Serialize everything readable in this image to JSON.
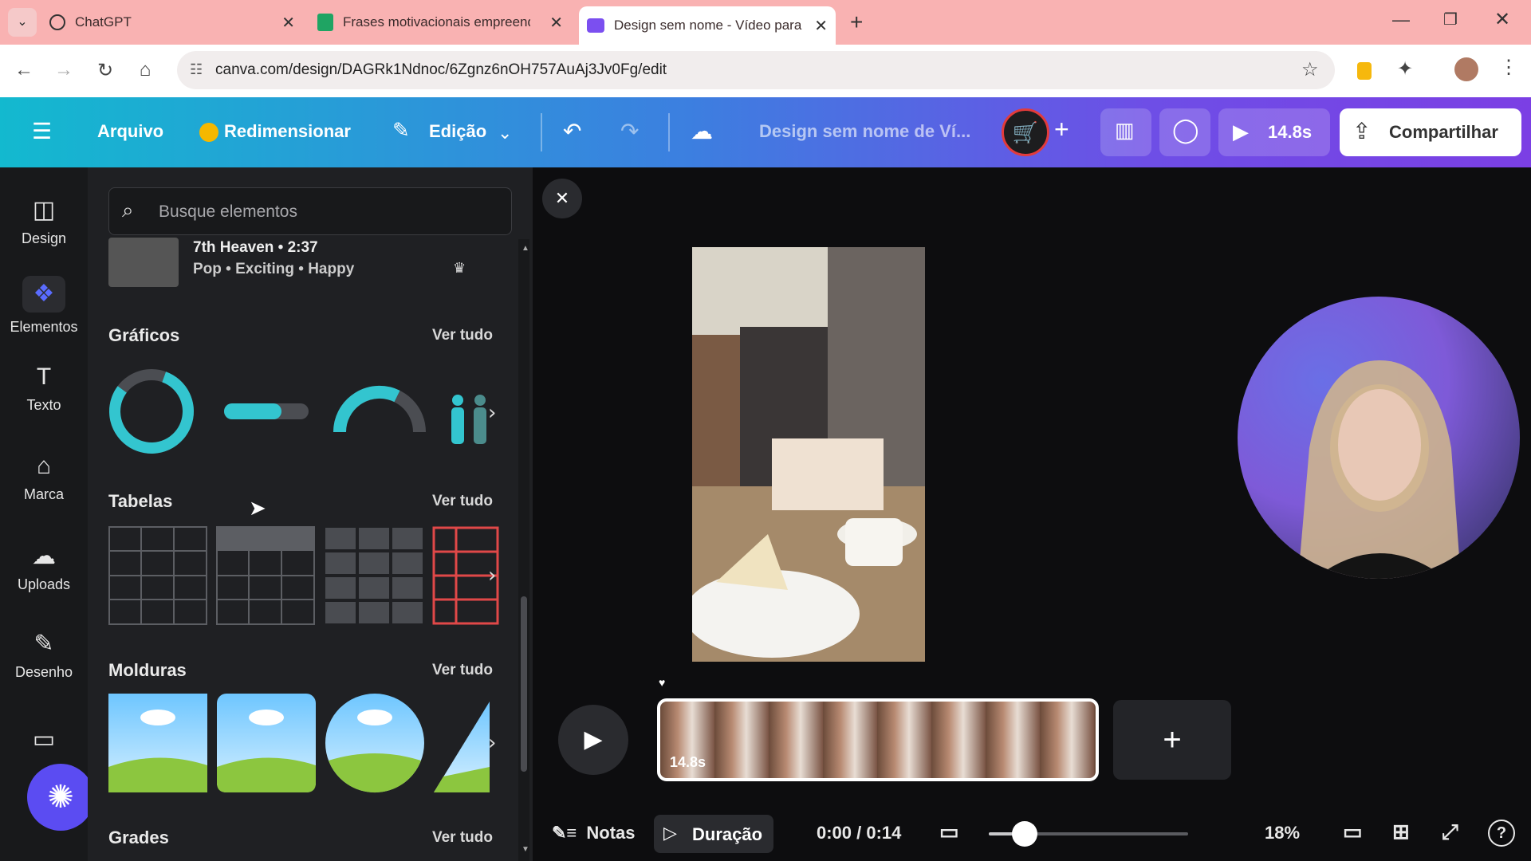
{
  "browser": {
    "tabs": [
      {
        "title": "ChatGPT",
        "icon": "chatgpt-icon"
      },
      {
        "title": "Frases motivacionais empreend",
        "icon": "sheets-icon"
      },
      {
        "title": "Design sem nome - Vídeo para",
        "icon": "canva-video-icon"
      }
    ],
    "url": "canva.com/design/DAGRk1Ndnoc/6Zgnz6nOH757AuAj3Jv0Fg/edit"
  },
  "toolbar": {
    "menu_label": "Arquivo",
    "resize_label": "Redimensionar",
    "edit_label": "Edição",
    "design_title": "Design sem nome de Ví...",
    "duration_label": "14.8s",
    "share_label": "Compartilhar"
  },
  "rail": {
    "items": [
      {
        "label": "Design",
        "icon": "design-icon"
      },
      {
        "label": "Elementos",
        "icon": "elements-icon"
      },
      {
        "label": "Texto",
        "icon": "text-icon"
      },
      {
        "label": "Marca",
        "icon": "brand-icon"
      },
      {
        "label": "Uploads",
        "icon": "upload-cloud-icon"
      },
      {
        "label": "Desenho",
        "icon": "draw-icon"
      }
    ]
  },
  "panel": {
    "search_placeholder": "Busque elementos",
    "audio": {
      "title": "7th Heaven • 2:37",
      "tags": "Pop • Exciting • Happy"
    },
    "sections": [
      {
        "title": "Gráficos",
        "see_all": "Ver tudo"
      },
      {
        "title": "Tabelas",
        "see_all": "Ver tudo"
      },
      {
        "title": "Molduras",
        "see_all": "Ver tudo"
      },
      {
        "title": "Grades",
        "see_all": "Ver tudo"
      }
    ]
  },
  "timeline": {
    "clip_duration": "14.8s"
  },
  "footer": {
    "notes_label": "Notas",
    "duration_label": "Duração",
    "time": "0:00 / 0:14",
    "zoom": "18%",
    "zoom_level": 0.18
  },
  "colors": {
    "toolbar_start": "#13b9cf",
    "toolbar_end": "#7b3fe4",
    "accent_teal": "#33c5cf",
    "panel_bg": "#1f2023"
  }
}
